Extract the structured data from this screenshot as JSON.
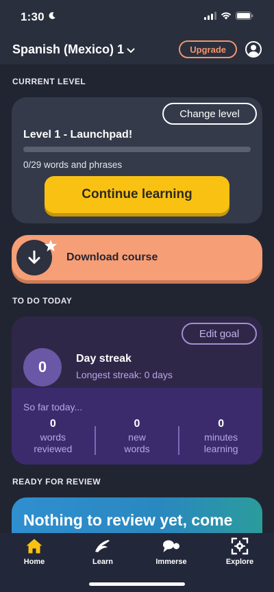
{
  "status_bar": {
    "time": "1:30"
  },
  "header": {
    "course_title": "Spanish (Mexico) 1",
    "upgrade_label": "Upgrade"
  },
  "current_level": {
    "section_title": "CURRENT LEVEL",
    "change_level_label": "Change level",
    "level_name": "Level 1 -  Launchpad!",
    "progress_fraction": 0,
    "words_count": "0/29 words and phrases",
    "continue_label": "Continue learning"
  },
  "download": {
    "label": "Download course"
  },
  "todo": {
    "section_title": "TO DO TODAY",
    "edit_goal_label": "Edit goal",
    "streak_value": "0",
    "streak_title": "Day streak",
    "longest_streak": "Longest streak: 0 days",
    "so_far_label": "So far today...",
    "stats": [
      {
        "value": "0",
        "line1": "words",
        "line2": "reviewed"
      },
      {
        "value": "0",
        "line1": "new",
        "line2": "words"
      },
      {
        "value": "0",
        "line1": "minutes",
        "line2": "learning"
      }
    ]
  },
  "review": {
    "section_title": "READY FOR REVIEW",
    "message": "Nothing to review yet, come"
  },
  "nav": {
    "items": [
      {
        "label": "Home",
        "icon": "home-icon",
        "active": true
      },
      {
        "label": "Learn",
        "icon": "learn-icon"
      },
      {
        "label": "Immerse",
        "icon": "immerse-icon"
      },
      {
        "label": "Explore",
        "icon": "explore-icon"
      }
    ]
  },
  "colors": {
    "background": "#212532",
    "accent_yellow": "#f9c213",
    "accent_orange": "#f69e76",
    "purple": "#3b2b6d"
  }
}
